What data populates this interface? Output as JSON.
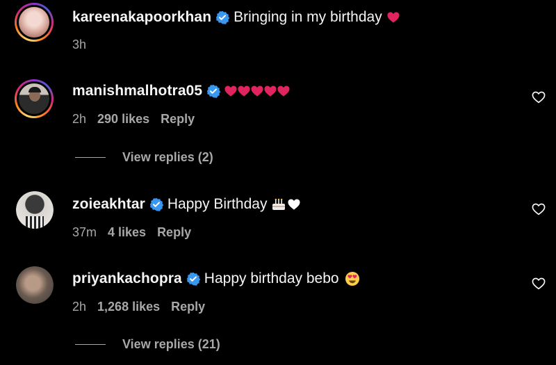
{
  "comments": [
    {
      "username": "kareenakapoorkhan",
      "text": "Bringing in my birthday",
      "time": "3h",
      "likes": "",
      "reply": "",
      "has_story_ring": true
    },
    {
      "username": "manishmalhotra05",
      "text": "",
      "hearts_count": 5,
      "time": "2h",
      "likes": "290 likes",
      "reply": "Reply",
      "view_replies": "View replies (2)",
      "has_story_ring": true
    },
    {
      "username": "zoieakhtar",
      "text": "Happy Birthday",
      "time": "37m",
      "likes": "4 likes",
      "reply": "Reply",
      "has_story_ring": false
    },
    {
      "username": "priyankachopra",
      "text": "Happy birthday bebo",
      "time": "2h",
      "likes": "1,268 likes",
      "reply": "Reply",
      "view_replies": "View replies (21)",
      "has_story_ring": false
    }
  ],
  "icons": {
    "verified": "verified-badge-icon",
    "like": "heart-outline-icon",
    "red_heart": "red-heart-emoji",
    "cake": "birthday-cake-emoji",
    "white_heart": "white-heart-emoji",
    "heart_eyes": "heart-eyes-emoji"
  },
  "colors": {
    "background": "#000000",
    "text": "#f5f5f5",
    "muted": "#a8a8a8",
    "verified_blue": "#3897f0",
    "heart_red": "#e0245e"
  }
}
